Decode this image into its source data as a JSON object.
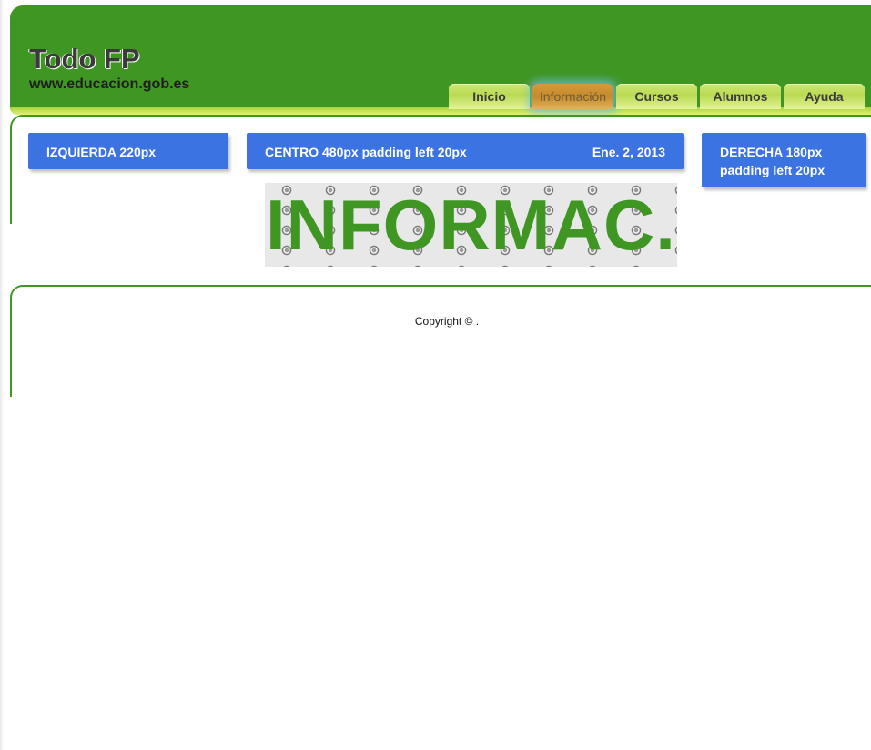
{
  "header": {
    "title": "Todo FP",
    "url": "www.educacion.gob.es"
  },
  "nav": {
    "items": [
      {
        "label": "Inicio",
        "active": false
      },
      {
        "label": "Información",
        "active": true
      },
      {
        "label": "Cursos",
        "active": false
      },
      {
        "label": "Alumnos",
        "active": false
      },
      {
        "label": "Ayuda",
        "active": false
      }
    ]
  },
  "columns": {
    "left": {
      "label": "IZQUIERDA 220px"
    },
    "center": {
      "label": "CENTRO 480px padding left 20px",
      "date": "Ene. 2, 2013"
    },
    "right": {
      "line1": "DERECHA 180px",
      "line2": "padding left 20px"
    }
  },
  "banner": {
    "text": "INFORMAC."
  },
  "footer": {
    "copyright": "Copyright © ."
  },
  "colors": {
    "header_green": "#3f9623",
    "box_blue": "#3b73e2",
    "tab_green": "#b9da52",
    "tab_active": "#c58a2b"
  }
}
